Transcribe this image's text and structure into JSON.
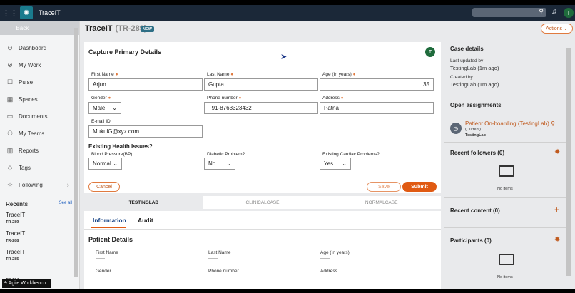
{
  "topbar": {
    "app_name": "TraceIT",
    "avatar_initial": "T"
  },
  "sidebar": {
    "back_label": "Back",
    "items": [
      {
        "label": "Dashboard",
        "icon": "⊙"
      },
      {
        "label": "My Work",
        "icon": "⊘"
      },
      {
        "label": "Pulse",
        "icon": "☐"
      },
      {
        "label": "Spaces",
        "icon": "▦"
      },
      {
        "label": "Documents",
        "icon": "▭"
      },
      {
        "label": "My Teams",
        "icon": "⚇"
      },
      {
        "label": "Reports",
        "icon": "▥"
      },
      {
        "label": "Tags",
        "icon": "◇"
      },
      {
        "label": "Following",
        "icon": "☆"
      }
    ],
    "recents_label": "Recents",
    "see_all": "See all",
    "recents": [
      {
        "title": "TraceIT",
        "sub": "TR-289"
      },
      {
        "title": "TraceIT",
        "sub": "TR-288"
      },
      {
        "title": "TraceIT",
        "sub": "TR-285"
      },
      {
        "title": "",
        "sub": "TR-194"
      }
    ],
    "tooltip": "Agile Workbench"
  },
  "header": {
    "title": "TraceIT",
    "case_id": "(TR-289)",
    "badge": "NEW",
    "actions_label": "Actions"
  },
  "capture": {
    "title": "Capture Primary Details",
    "avatar_initial": "T",
    "first_name_label": "First Name",
    "first_name": "Arjun",
    "last_name_label": "Last Name",
    "last_name": "Gupta",
    "age_label": "Age (In years)",
    "age": "35",
    "gender_label": "Gender",
    "gender": "Male",
    "phone_label": "Phone number",
    "phone": "+91-8763323432",
    "address_label": "Address",
    "address": "Patna",
    "email_label": "E-mail ID",
    "email": "MukulG@xyz.com",
    "health_title": "Existing Health Issues?",
    "bp_label": "Blood Pressure(BP)",
    "bp": "Normal",
    "diabetic_label": "Diabetic Problem?",
    "diabetic": "No",
    "cardiac_label": "Existing Cardiac Problems?",
    "cardiac": "Yes",
    "cancel": "Cancel",
    "save": "Save",
    "submit": "Submit"
  },
  "stages": [
    "TESTINGLAB",
    "CLINICALCASE",
    "NORMALCASE"
  ],
  "info": {
    "tabs": [
      "Information",
      "Audit"
    ],
    "section_title": "Patient Details",
    "fields": [
      "First Name",
      "Last Name",
      "Age (In years)",
      "Gender",
      "Phone number",
      "Address"
    ],
    "empty_value": "——"
  },
  "right_panel": {
    "case_details": "Case details",
    "last_updated_label": "Last updated by",
    "last_updated_value": "TestingLab (1m ago)",
    "created_label": "Created by",
    "created_value": "TestingLab (1m ago)",
    "open_assignments": "Open assignments",
    "assignment_link": "Patient On-boarding (TestingLab)",
    "assignment_current": "(Current)",
    "assignment_owner": "TestingLab",
    "recent_followers": "Recent followers (0)",
    "recent_content": "Recent content (0)",
    "participants": "Participants (0)",
    "no_items": "No items"
  }
}
